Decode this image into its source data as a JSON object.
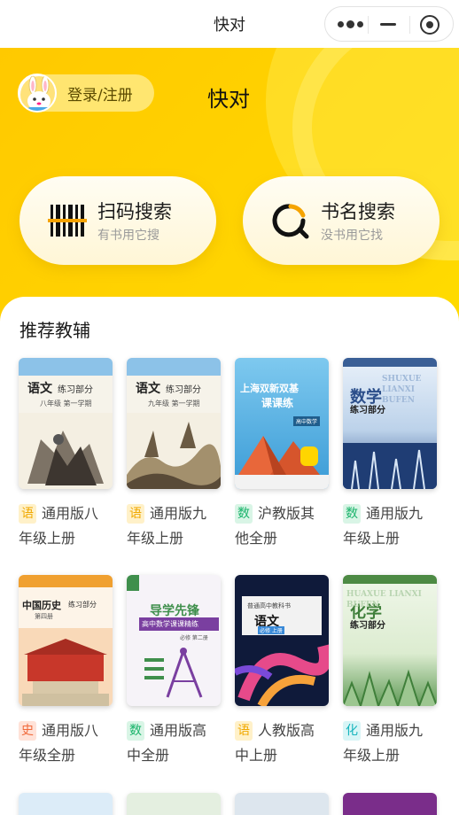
{
  "topbar": {
    "title": "快对"
  },
  "header": {
    "login_label": "登录/注册",
    "title": "快对",
    "scan_search": {
      "label": "扫码搜索",
      "sub": "有书用它搜",
      "icon": "barcode-icon"
    },
    "name_search": {
      "label": "书名搜索",
      "sub": "没书用它找",
      "icon": "search-icon"
    }
  },
  "section": {
    "title": "推荐教辅"
  },
  "books": [
    {
      "tag": "语",
      "line1": "通用版八",
      "line2": "年级上册",
      "cover_title": "语文",
      "cover_sub": "练习部分",
      "cover_grade": "八年级 第一学期"
    },
    {
      "tag": "语",
      "line1": "通用版九",
      "line2": "年级上册",
      "cover_title": "语文",
      "cover_sub": "练习部分",
      "cover_grade": "九年级 第一学期"
    },
    {
      "tag": "数",
      "line1": "沪教版其",
      "line2": "他全册",
      "cover_title": "上海双新双基",
      "cover_sub": "课课练",
      "cover_grade": "高中数学"
    },
    {
      "tag": "数",
      "line1": "通用版九",
      "line2": "年级上册",
      "cover_title": "数学",
      "cover_sub": "练习部分",
      "cover_grade": "SHUXUE LIANXI BUFEN"
    },
    {
      "tag": "史",
      "line1": "通用版八",
      "line2": "年级全册",
      "cover_title": "中国历史",
      "cover_sub": "练习部分",
      "cover_grade": "第四册"
    },
    {
      "tag": "数",
      "line1": "通用版高",
      "line2": "中全册",
      "cover_title": "导学先锋",
      "cover_sub": "高中数学课课精练",
      "cover_grade": "必修 第二册"
    },
    {
      "tag": "语",
      "line1": "人教版高",
      "line2": "中上册",
      "cover_title": "语文",
      "cover_sub": "普通高中教科书",
      "cover_grade": "必修 上册"
    },
    {
      "tag": "化",
      "line1": "通用版九",
      "line2": "年级上册",
      "cover_title": "化学",
      "cover_sub": "练习部分",
      "cover_grade": "HUAXUE LIANXI BUFEN"
    }
  ]
}
